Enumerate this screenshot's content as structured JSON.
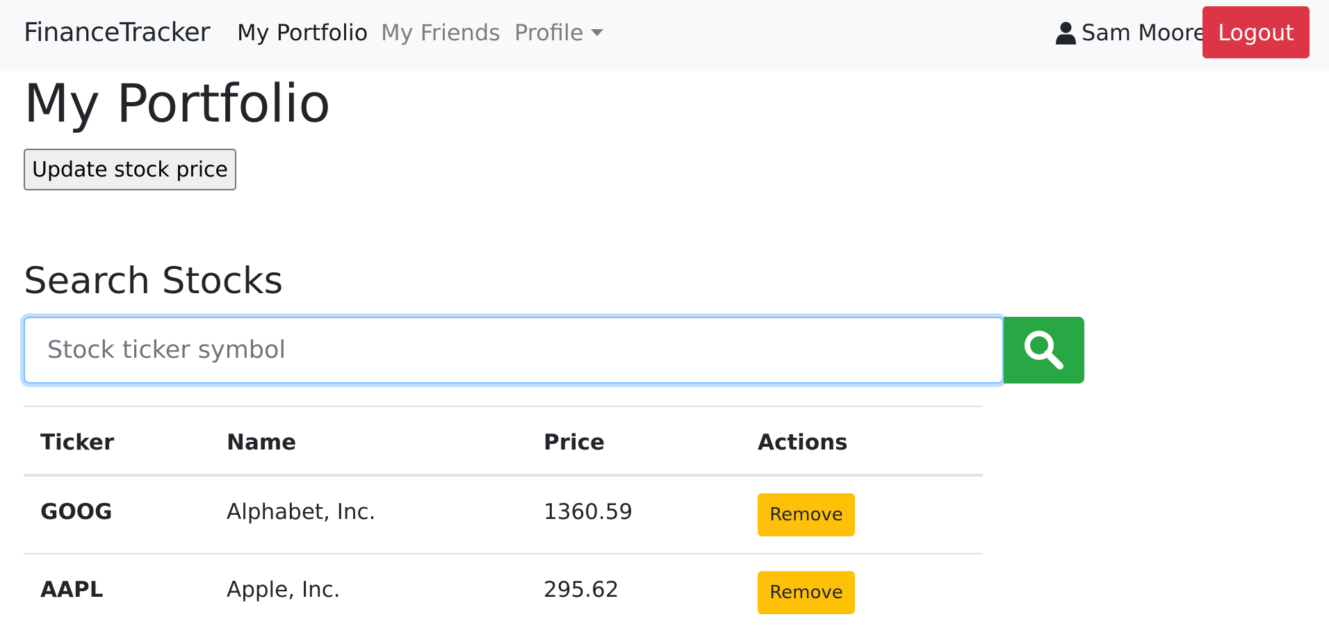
{
  "navbar": {
    "brand": "FinanceTracker",
    "links": [
      {
        "label": "My Portfolio",
        "active": true
      },
      {
        "label": "My Friends",
        "active": false
      },
      {
        "label": "Profile",
        "active": false
      }
    ],
    "user_icon": "user-icon",
    "user_name": "Sam Moore",
    "logout_label": "Logout"
  },
  "main": {
    "title": "My Portfolio",
    "update_label": "Update stock price",
    "search": {
      "title": "Search Stocks",
      "placeholder": "Stock ticker symbol",
      "value": "",
      "button_icon": "search-icon"
    },
    "table": {
      "headers": [
        "Ticker",
        "Name",
        "Price",
        "Actions"
      ],
      "rows": [
        {
          "ticker": "GOOG",
          "name": "Alphabet, Inc.",
          "price": "1360.59",
          "action": "Remove"
        },
        {
          "ticker": "AAPL",
          "name": "Apple, Inc.",
          "price": "295.62",
          "action": "Remove"
        }
      ]
    }
  },
  "colors": {
    "navbar_bg": "#f8f9fa",
    "logout": "#dc3545",
    "search_button": "#28a745",
    "remove_button": "#ffc107",
    "focus_ring": "#80bdff"
  }
}
